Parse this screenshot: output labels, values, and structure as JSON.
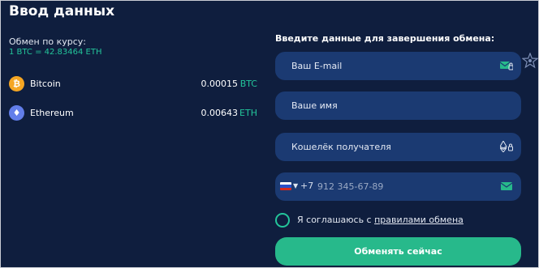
{
  "title": "Ввод данных",
  "rate": {
    "label": "Обмен по курсу:",
    "value": "1 BTC = 42.83464 ETH"
  },
  "coins": [
    {
      "symbol": "₿",
      "name": "Bitcoin",
      "amount": "0.00015",
      "ticker": "BTC",
      "color": "#f5a623"
    },
    {
      "symbol": "♦",
      "name": "Ethereum",
      "amount": "0.00643",
      "ticker": "ETH",
      "color": "#627eea"
    }
  ],
  "form": {
    "heading": "Введите данные для завершения обмена:",
    "email_placeholder": "Ваш E-mail",
    "name_placeholder": "Ваше имя",
    "wallet_placeholder": "Кошелёк получателя",
    "phone_prefix": "+7",
    "phone_placeholder": "912 345-67-89",
    "agree_text": "Я соглашаюсь с ",
    "agree_link": "правилами обмена",
    "submit_label": "Обменять сейчас"
  },
  "colors": {
    "background": "#0f1e3e",
    "field": "#1b3a72",
    "accent": "#27b98b",
    "accent_text": "#23c59a"
  },
  "icons": {
    "email_field": "envelope-lock-icon",
    "wallet_field": "ethereum-lock-icon",
    "phone_field": "envelope-icon",
    "side": "star-badge-icon",
    "country": "russia-flag-icon"
  }
}
